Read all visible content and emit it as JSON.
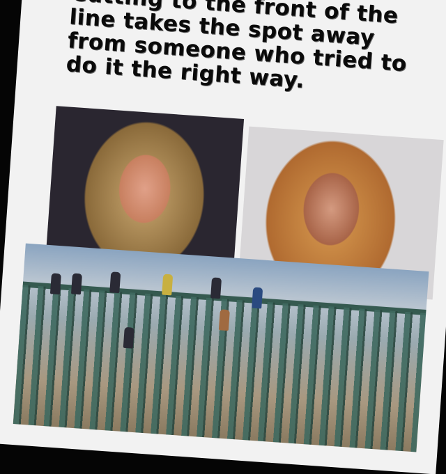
{
  "meme": {
    "caption": "Cutting to the front of the line takes the spot away from someone who tried to do it the right way."
  }
}
